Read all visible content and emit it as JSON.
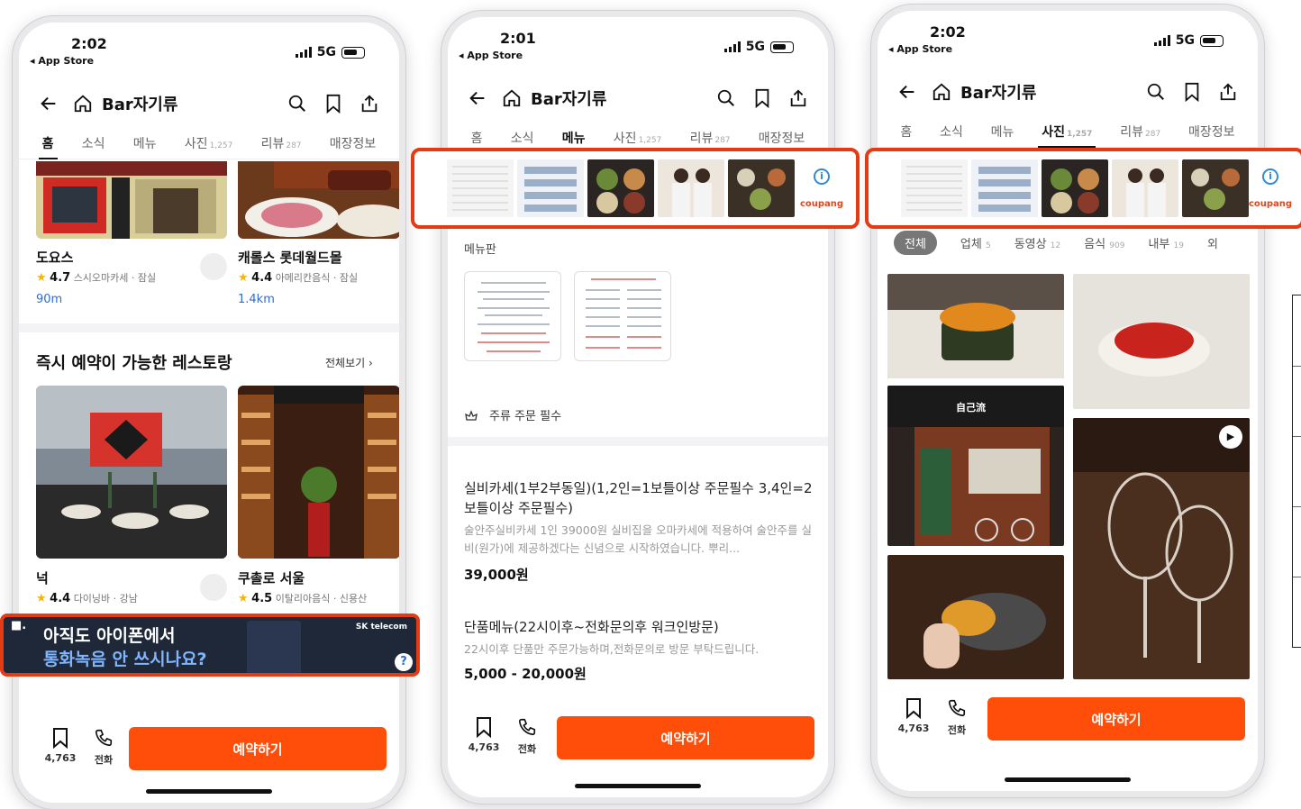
{
  "app": {
    "title": "Bar자기류",
    "reserve_label": "예약하기",
    "bookmark_count": "4,763",
    "call_label": "전화",
    "network": "5G",
    "back_app": "◂ App Store"
  },
  "tabs": [
    {
      "label": "홈",
      "count": ""
    },
    {
      "label": "소식",
      "count": ""
    },
    {
      "label": "메뉴",
      "count": ""
    },
    {
      "label": "사진",
      "count": "1,257"
    },
    {
      "label": "리뷰",
      "count": "287"
    },
    {
      "label": "매장정보",
      "count": ""
    }
  ],
  "phone1": {
    "time": "2:02",
    "places": [
      {
        "name": "도요스",
        "rating": "4.7",
        "meta": "스시오마카세 · 잠실",
        "distance": "90m"
      },
      {
        "name": "캐롤스 롯데월드몰",
        "rating": "4.4",
        "meta": "아메리칸음식 · 잠실",
        "distance": "1.4km"
      }
    ],
    "section_title": "즉시 예약이 가능한 레스토랑",
    "section_more": "전체보기 ›",
    "restaurants": [
      {
        "name": "넉",
        "rating": "4.4",
        "meta": "다이닝바 · 강남"
      },
      {
        "name": "쿠촐로 서울",
        "rating": "4.5",
        "meta": "이탈리아음식 · 신용산"
      }
    ],
    "ad": {
      "line1": "아직도 아이폰에서",
      "line2": "통화녹음 안 쓰시나요?",
      "brand": "SK telecom"
    }
  },
  "phone2": {
    "time": "2:01",
    "ad_brand": "coupang",
    "menu_board_label": "메뉴판",
    "notice": "주류 주문 필수",
    "items": [
      {
        "title": "실비카세(1부2부동일)(1,2인=1보틀이상 주문필수 3,4인=2보틀이상 주문필수)",
        "desc": "술안주실비카세 1인 39000원 실비집을 오마카세에 적용하여 술안주를 실비(원가)에 제공하겠다는 신념으로 시작하였습니다. 뿌리...",
        "price": "39,000원"
      },
      {
        "title": "단품메뉴(22시이후~전화문의후 워크인방문)",
        "desc": "22시이후 단품만 주문가능하며,전화문의로 방문 부탁드립니다.",
        "price": "5,000 - 20,000원"
      }
    ]
  },
  "phone3": {
    "time": "2:02",
    "ad_brand": "coupang",
    "filters": [
      {
        "label": "전체",
        "count": ""
      },
      {
        "label": "업체",
        "count": "5"
      },
      {
        "label": "동영상",
        "count": "12"
      },
      {
        "label": "음식",
        "count": "909"
      },
      {
        "label": "내부",
        "count": "19"
      },
      {
        "label": "외",
        "count": ""
      }
    ],
    "storefront_sign": "自己流"
  },
  "colors": {
    "accent": "#ff4e0a",
    "highlight": "#e43b14",
    "link": "#2f6bd8",
    "star": "#f7b500"
  }
}
